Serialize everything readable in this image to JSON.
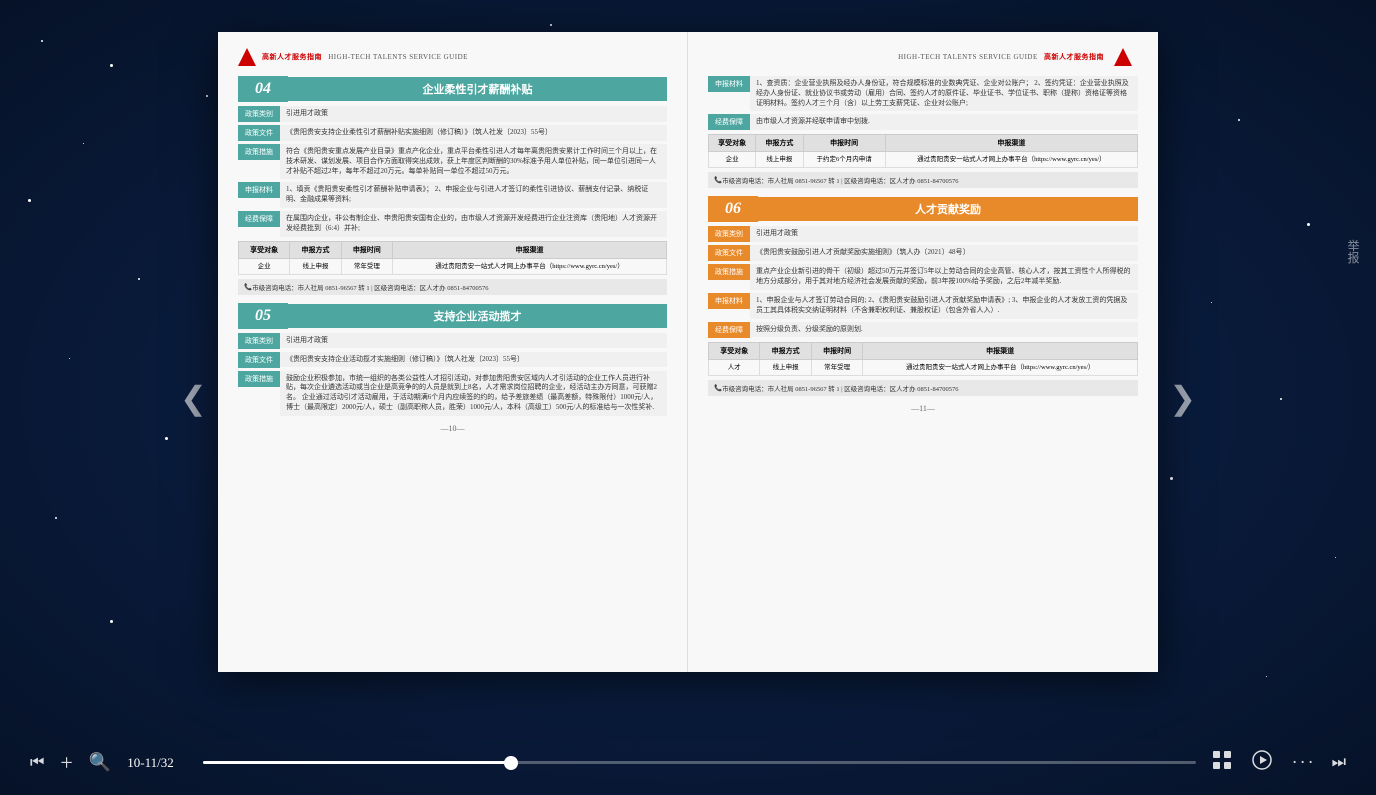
{
  "app": {
    "title": "高新人才服务指南",
    "subtitle_en": "HIGH-TECH TALENTS SERVICE GUIDE"
  },
  "pages": {
    "current": "10-11",
    "total": "32",
    "indicator": "10-11/32"
  },
  "progress": {
    "percent": 31,
    "thumb_percent": 31
  },
  "left_page": {
    "number": "—10—",
    "header": {
      "cn": "高新人才服务指南",
      "en": "HIGH-TECH TALENTS SERVICE GUIDE"
    },
    "section04": {
      "number": "04",
      "title": "企业柔性引才薪酬补贴",
      "rows": [
        {
          "label": "政策类别",
          "content": "引进用才政策"
        },
        {
          "label": "政策文件",
          "content": "《贵阳贵安支持企业柔性引才薪酬补贴实施细则（修订稿）》〔筑人社发〔2023〕55号〕"
        },
        {
          "label": "政策措施",
          "content": "符合《贵阳贵安重点发展产业目录》重点产化企业，重点平台柔性引进人才每年离贵阳贵安累计工作时间三个月以上，在技术研发、谋划发展、项目合作方面取得突出成效，获上年度区判断酬的30%标准予用人单位补贴，同一单位引进同一人才补贴不超过2年，每年不超过20万元。每单补贴同一单位不超过50万元。"
        },
        {
          "label": "申报材料",
          "content": "1、填贡《贵阳贵安柔性引才薪酬补贴申请表》；\n2、申报企业与引进人才签订的柔性引进协议、薪酬支付记录、纳税证明、金融成果等资料;"
        },
        {
          "label": "经费保障",
          "content": "在属围内企业，非公有制企业、申贵阳贵安国有企业的，由市级人才资源开发经费进行企业注资库（贵阳地）人才资源开发经费批到（6:4）并补;"
        }
      ],
      "table": {
        "headers": [
          "享受对象",
          "申报方式",
          "申报时间",
          "申报渠道"
        ],
        "rows": [
          [
            "企业",
            "线上申报",
            "常年受理",
            "通过贵阳贵安一站式人才网上办事平台（https://www.gyrc.cn/yes/）"
          ]
        ]
      },
      "contact": "市级咨询电话：市人社局 0851-96567 转 1 | 区级咨询电话：区人才办 0851-84700576"
    },
    "section05": {
      "number": "05",
      "title": "支持企业活动揽才",
      "rows": [
        {
          "label": "政策类别",
          "content": "引进用才政策"
        },
        {
          "label": "政策文件",
          "content": "《贵阳贵安支持企业活动揽才实施细则（修订稿）》〔筑人社发〔2023〕55号〕"
        },
        {
          "label": "政策措施",
          "content": "鼓励企业积极参加，市统一组织的各类公益性人才招引活动，对参加贵阳贵安区域内人才引活动的企业工作人员进行补贴，每次企业遴选活动或当企业是高竞争的的人员是就到上8名，人才需求岗位招聘的企业，经活动主办方同意，可获赠2名。\n企业通过活动引才活动雇用，于活动期满6个月内应续签的约的，给予差旅差绩（最高差额，特殊限付）1000元/人，博士（最高限定）2000元/人，硕士（副高职称人员，胜荣）1000元/人，本科（高级工）500元/人的标准给与一次性奖补."
        }
      ]
    }
  },
  "right_page": {
    "number": "—11—",
    "header": {
      "cn": "高新人才服务指南",
      "en": "HIGH-TECH TALENTS SERVICE GUIDE"
    },
    "section_apply": {
      "rows": [
        {
          "label": "申报材料",
          "content": "1、查资质：企业营业执照及经办人身份证，符合规模标准的业数典凭证、企业对公账户；\n2、签约凭证：企业营业执照及经办人身份证、就业协议书或劳动（雇用）合同、签约人才的原件证、毕业证书、学位证书、职称（提称）资格证等资格证明材料。签约人才三个月（含）以上劳工支薪凭证、企业对公账户;"
        },
        {
          "label": "经费保障",
          "content": "由市级人才资源并经联申请审中划拨."
        }
      ],
      "table": {
        "headers": [
          "享受对象",
          "申报方式",
          "申报时间",
          "申报渠道"
        ],
        "rows": [
          [
            "企业",
            "线上申报",
            "于约定6个月内申请",
            "通过贵阳贵安一站式人才网上办事平台（https://www.gyrc.cn/yes/）"
          ]
        ]
      },
      "contact": "市级咨询电话：市人社局 0851-96567 转 1 | 区级咨询电话：区人才办 0851-84700576"
    },
    "section06": {
      "number": "06",
      "title": "人才贡献奖励",
      "rows": [
        {
          "label": "政策类别",
          "content": "引进用才政策"
        },
        {
          "label": "政策文件",
          "content": "《贵阳贵安鼓励引进人才贡献奖励实施细则》〔筑人办〔2021〕48号〕"
        },
        {
          "label": "政策措施",
          "content": "重点产业企业新引进的骨干（初级）超过50万元并签订5年以上劳动合同的企业高管、核心人才，按其工资性个人所得税的地方分成部分，用于其对地方经济社会发展贡献的奖励，前3年按100%给予奖励，之后2年减半奖励."
        },
        {
          "label": "申报材料",
          "content": "1、申报企业与人才签订劳动合同的;\n2、《贵阳贵安鼓励引进人才贡献奖励申请表》;\n3、申报企业的人才发放工资的凭据及员工其具体税实交纳证明材料（不含兼职权利证、兼股权证）（包含外省人入）."
        },
        {
          "label": "经费保障",
          "content": "按照分级负责、分级奖励的原则划."
        }
      ],
      "table": {
        "headers": [
          "享受对象",
          "申报方式",
          "申报时间",
          "申报渠道"
        ],
        "rows": [
          [
            "人才",
            "线上申报",
            "常年受理",
            "通过贵阳贵安一站式人才网上办事平台（https://www.gyrc.cn/yes/）"
          ]
        ]
      },
      "contact": "市级咨询电话：市人社局 0851-96567 转 1 | 区级咨询电话：区人才办 0851-84700576"
    }
  },
  "nav": {
    "prev": "❮",
    "next": "❯",
    "prev_fast": "⏮",
    "next_fast": "⏭"
  },
  "toolbar": {
    "add_label": "+",
    "search_label": "🔍",
    "grid_label": "⊞",
    "play_label": "▶",
    "more_label": "···",
    "report_label": "举报"
  },
  "colors": {
    "teal": "#4da6a0",
    "orange": "#e8892a",
    "blue_header": "#4a7fc1",
    "green": "#5aaa6a",
    "bg": "#0a1a3a"
  }
}
